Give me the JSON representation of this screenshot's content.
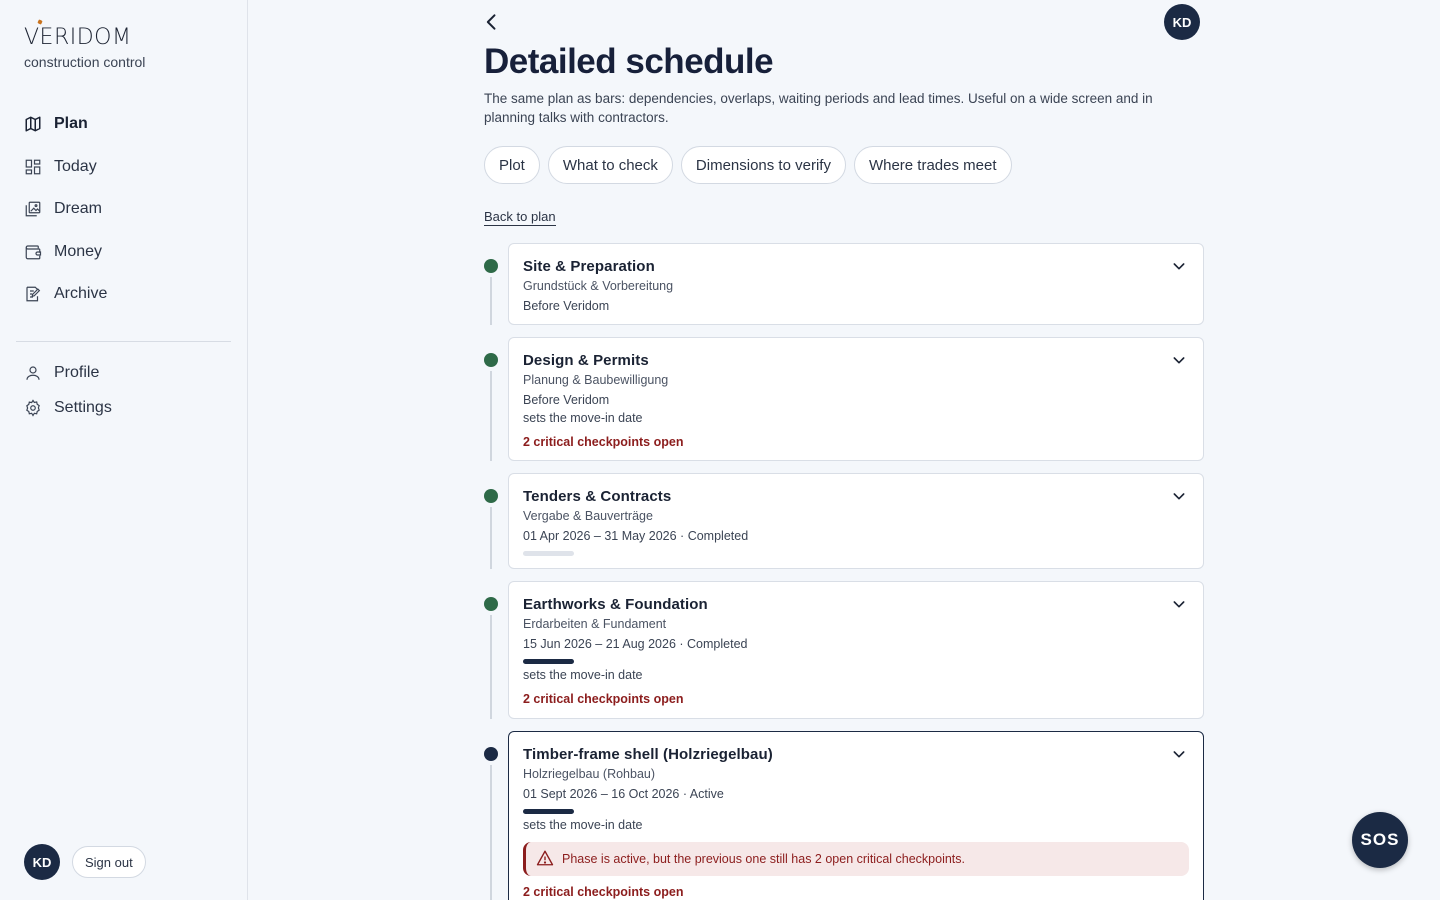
{
  "brand": {
    "name": "VERIDOM",
    "subtitle": "construction control"
  },
  "nav": {
    "items": [
      {
        "label": "Plan",
        "icon": "map-icon",
        "active": true
      },
      {
        "label": "Today",
        "icon": "grid-icon"
      },
      {
        "label": "Dream",
        "icon": "image-icon"
      },
      {
        "label": "Money",
        "icon": "wallet-icon"
      },
      {
        "label": "Archive",
        "icon": "archive-edit-icon"
      }
    ],
    "secondary": [
      {
        "label": "Profile",
        "icon": "user-icon"
      },
      {
        "label": "Settings",
        "icon": "gear-icon"
      }
    ]
  },
  "user": {
    "initials": "KD",
    "signout_label": "Sign out"
  },
  "page": {
    "title": "Detailed schedule",
    "intro": "The same plan as bars: dependencies, overlaps, waiting periods and lead times. Useful on a wide screen and in planning talks with contractors.",
    "chips": [
      "Plot",
      "What to check",
      "Dimensions to verify",
      "Where trades meet"
    ],
    "back_link": "Back to plan"
  },
  "phases": [
    {
      "title": "Site & Preparation",
      "subtitle": "Grundstück & Vorbereitung",
      "line": "Before Veridom"
    },
    {
      "title": "Design & Permits",
      "subtitle": "Planung & Baubewilligung",
      "line": "Before Veridom",
      "note": "sets the move-in date",
      "critical": "2 critical checkpoints open"
    },
    {
      "title": "Tenders & Contracts",
      "subtitle": "Vergabe & Bauverträge",
      "line": "01 Apr 2026 – 31 May 2026 · Completed",
      "progress": 0
    },
    {
      "title": "Earthworks & Foundation",
      "subtitle": "Erdarbeiten & Fundament",
      "line": "15 Jun 2026 – 21 Aug 2026 · Completed",
      "progress": 1,
      "note": "sets the move-in date",
      "critical": "2 critical checkpoints open"
    },
    {
      "title": "Timber-frame shell (Holzriegelbau)",
      "subtitle": "Holzriegelbau (Rohbau)",
      "line": "01 Sept 2026 – 16 Oct 2026 · Active",
      "progress": 1,
      "note": "sets the move-in date",
      "warning": "Phase is active, but the previous one still has 2 open critical checkpoints.",
      "critical": "2 critical checkpoints open"
    }
  ],
  "sos_label": "SOS",
  "colors": {
    "done_dot": "#2e6a48",
    "active_dot": "#1b2a44",
    "critical": "#8c1d1d",
    "navy": "#1b2a44"
  }
}
